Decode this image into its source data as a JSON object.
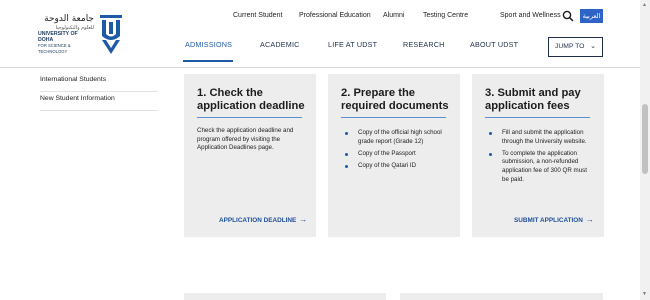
{
  "logo": {
    "arabic": "جامعة الدوحة",
    "arabic_sub": "للعلوم والتكنولوجيا",
    "english_name": "UNIVERSITY OF DOHA",
    "english_sub": "FOR SCIENCE & TECHNOLOGY"
  },
  "top_nav": {
    "items": [
      "Current Student",
      "Professional Education",
      "Alumni",
      "Testing Centre",
      "Sport and Wellness"
    ],
    "search_icon": "search-icon",
    "language_label": "العربية",
    "language_color": "#2e63c8"
  },
  "main_nav": {
    "items": [
      "ADMISSIONS",
      "ACADEMIC",
      "LIFE AT UDST",
      "RESEARCH",
      "ABOUT UDST"
    ],
    "active": "ADMISSIONS",
    "jump_label": "JUMP TO"
  },
  "sidebar": {
    "items": [
      "International Students",
      "New Student Information"
    ]
  },
  "cards": [
    {
      "title": "1. Check the application deadline",
      "body": "Check the application deadline and program offered by visiting the Application Deadlines page.",
      "link": "APPLICATION DEADLINE"
    },
    {
      "title": "2. Prepare the required documents",
      "bullets": [
        "Copy of the official high school grade report (Grade 12)",
        "Copy of the Passport",
        "Copy of the Qatari ID"
      ]
    },
    {
      "title": "3. Submit and pay application fees",
      "bullets": [
        "Fill and submit the application through the University website.",
        "To complete the application submission, a non-refunded application fee of 300 QR must be paid."
      ],
      "link": "SUBMIT APPLICATION"
    }
  ],
  "colors": {
    "accent": "#1f5aa6",
    "card_bg": "#ededed",
    "navy": "#1f2f4a"
  }
}
